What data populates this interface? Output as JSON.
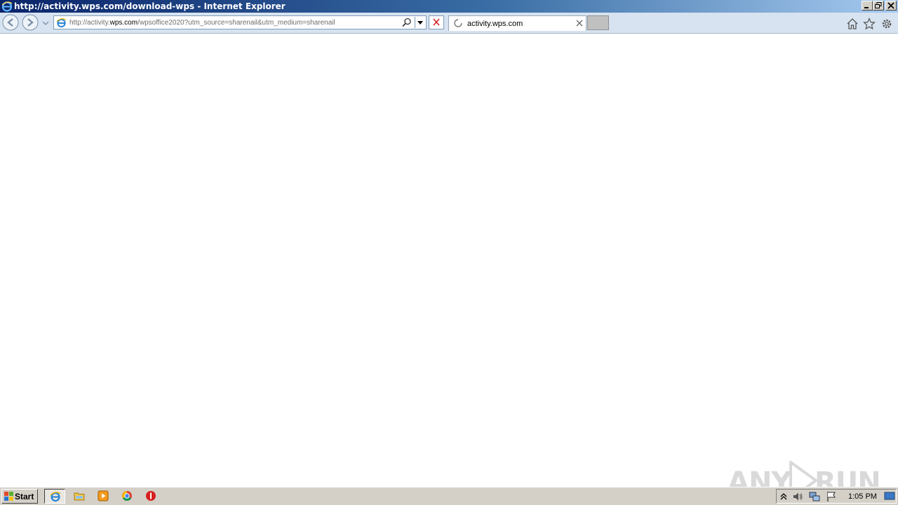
{
  "window": {
    "title": "http://activity.wps.com/download-wps - Internet Explorer"
  },
  "toolbar": {
    "address": {
      "prefix": "http://activity.",
      "domain": "wps.com",
      "path": "/wpsoffice2020?utm_source=sharenail&utm_medium=sharenail"
    }
  },
  "tabs": [
    {
      "title": "activity.wps.com",
      "loading": true
    }
  ],
  "watermark": {
    "left": "ANY",
    "right": "RUN"
  },
  "taskbar": {
    "start_label": "Start",
    "apps": [
      "internet-explorer",
      "file-explorer",
      "media-player",
      "chrome",
      "stop-app"
    ],
    "clock": "1:05 PM"
  },
  "colors": {
    "title_gradient_start": "#0a246a",
    "toolbar_bg": "#d7e3f0",
    "taskbar_bg": "#d4d0c8"
  }
}
